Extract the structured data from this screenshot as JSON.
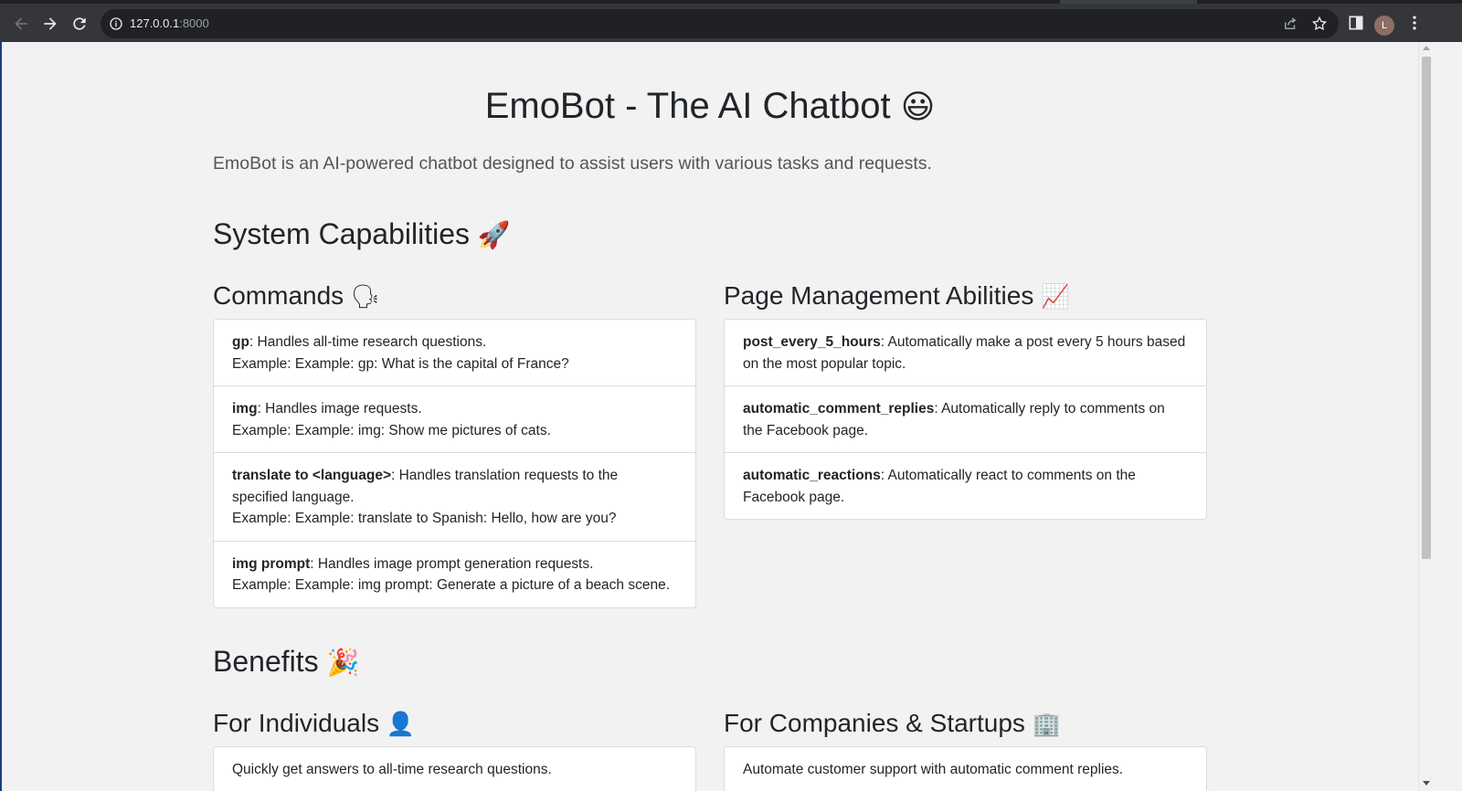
{
  "browser": {
    "url_host": "127.0.0.1",
    "url_port": ":8000",
    "profile_initial": "L"
  },
  "page": {
    "title": "EmoBot - The AI Chatbot",
    "title_emoji": "😃",
    "lead": "EmoBot is an AI-powered chatbot designed to assist users with various tasks and requests."
  },
  "capabilities": {
    "heading": "System Capabilities",
    "heading_emoji": "🚀",
    "commands": {
      "heading": "Commands",
      "heading_emoji": "🗣",
      "items": [
        {
          "name": "gp",
          "desc": ": Handles all-time research questions.",
          "example": "Example: Example: gp: What is the capital of France?"
        },
        {
          "name": "img",
          "desc": ": Handles image requests.",
          "example": "Example: Example: img: Show me pictures of cats."
        },
        {
          "name": "translate to <language>",
          "desc": ": Handles translation requests to the specified language.",
          "example": "Example: Example: translate to Spanish: Hello, how are you?"
        },
        {
          "name": "img prompt",
          "desc": ": Handles image prompt generation requests.",
          "example": "Example: Example: img prompt: Generate a picture of a beach scene."
        }
      ]
    },
    "page_management": {
      "heading": "Page Management Abilities",
      "heading_emoji": "📈",
      "items": [
        {
          "name": "post_every_5_hours",
          "desc": ": Automatically make a post every 5 hours based on the most popular topic."
        },
        {
          "name": "automatic_comment_replies",
          "desc": ": Automatically reply to comments on the Facebook page."
        },
        {
          "name": "automatic_reactions",
          "desc": ": Automatically react to comments on the Facebook page."
        }
      ]
    }
  },
  "benefits": {
    "heading": "Benefits",
    "heading_emoji": "🎉",
    "individuals": {
      "heading": "For Individuals",
      "heading_emoji": "👤",
      "items": [
        "Quickly get answers to all-time research questions."
      ]
    },
    "companies": {
      "heading": "For Companies & Startups",
      "heading_emoji": "🏢",
      "items": [
        "Automate customer support with automatic comment replies."
      ]
    }
  }
}
